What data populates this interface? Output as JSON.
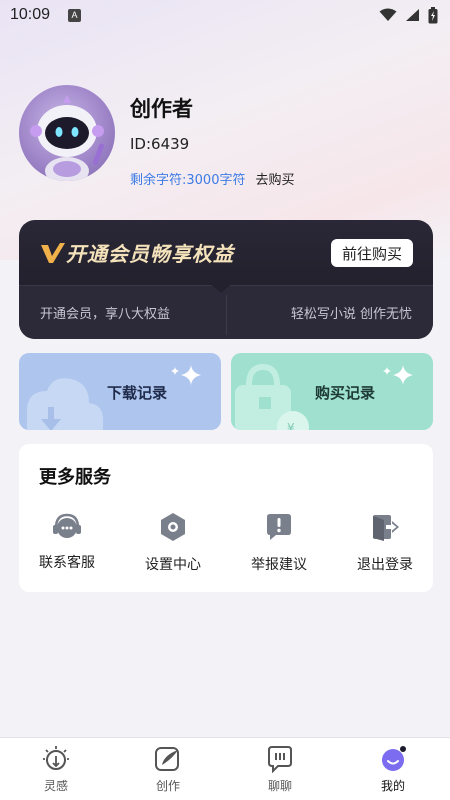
{
  "status_bar": {
    "time": "10:09",
    "notification_icon": "A"
  },
  "profile": {
    "username": "创作者",
    "user_id": "ID:6439",
    "chars_remaining": "剩余字符:3000字符",
    "buy_link": "去购买"
  },
  "vip": {
    "title": "开通会员畅享权益",
    "buy_button": "前往购买",
    "benefit_left": "开通会员，享八大权益",
    "benefit_right": "轻松写小说 创作无忧",
    "accent_color": "#f0b04a"
  },
  "records": {
    "download": "下载记录",
    "purchase": "购买记录"
  },
  "services": {
    "title": "更多服务",
    "items": [
      {
        "label": "联系客服",
        "icon": "headset-icon"
      },
      {
        "label": "设置中心",
        "icon": "settings-icon"
      },
      {
        "label": "举报建议",
        "icon": "report-icon"
      },
      {
        "label": "退出登录",
        "icon": "logout-icon"
      }
    ]
  },
  "tabs": [
    {
      "label": "灵感",
      "icon": "bulb-icon"
    },
    {
      "label": "创作",
      "icon": "create-icon"
    },
    {
      "label": "聊聊",
      "icon": "chat-icon"
    },
    {
      "label": "我的",
      "icon": "profile-icon",
      "active": true
    }
  ]
}
